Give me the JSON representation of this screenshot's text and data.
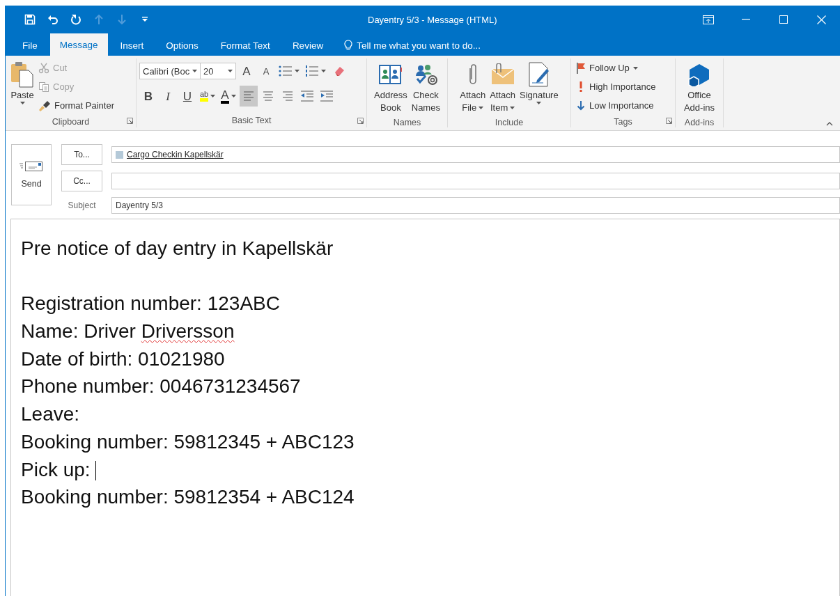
{
  "window": {
    "title": "Dayentry 5/3 - Message (HTML)"
  },
  "quick_access": [
    {
      "kind": "save",
      "disabled": false
    },
    {
      "kind": "undo",
      "disabled": false
    },
    {
      "kind": "redo",
      "disabled": false
    },
    {
      "kind": "up",
      "disabled": true
    },
    {
      "kind": "down",
      "disabled": true
    },
    {
      "kind": "customize",
      "disabled": false
    }
  ],
  "window_controls": [
    {
      "kind": "ribbon-display"
    },
    {
      "kind": "minimize"
    },
    {
      "kind": "maximize"
    },
    {
      "kind": "close"
    }
  ],
  "tabs": [
    {
      "label": "File",
      "selected": false
    },
    {
      "label": "Message",
      "selected": true
    },
    {
      "label": "Insert",
      "selected": false
    },
    {
      "label": "Options",
      "selected": false
    },
    {
      "label": "Format Text",
      "selected": false
    },
    {
      "label": "Review",
      "selected": false
    }
  ],
  "tell_me": {
    "placeholder": "Tell me what you want to do..."
  },
  "ribbon": {
    "groups": [
      {
        "kind": "clipboard",
        "label": "Clipboard",
        "launcher": true,
        "paste": {
          "label": "Paste",
          "dropdown": true
        },
        "items": [
          {
            "kind": "cut",
            "label": "Cut",
            "disabled": true
          },
          {
            "kind": "copy",
            "label": "Copy",
            "disabled": true
          },
          {
            "kind": "format-painter",
            "label": "Format Painter",
            "disabled": false
          }
        ]
      },
      {
        "kind": "basic-text",
        "label": "Basic Text",
        "launcher": true,
        "font": "Calibri (Boc",
        "size": "20",
        "row_1": [
          {
            "kind": "grow-font",
            "glyph": "A"
          },
          {
            "kind": "shrink-font",
            "glyph": "A"
          },
          {
            "kind": "bullets",
            "dropdown": true
          },
          {
            "kind": "numbering",
            "dropdown": true
          },
          {
            "kind": "clear-formatting"
          }
        ],
        "row_2": [
          {
            "kind": "bold",
            "glyph": "B"
          },
          {
            "kind": "italic",
            "glyph": "I"
          },
          {
            "kind": "underline",
            "glyph": "U"
          },
          {
            "kind": "highlight",
            "glyph": "ab",
            "dropdown": true
          },
          {
            "kind": "font-color",
            "glyph": "A",
            "dropdown": true
          },
          {
            "kind": "align-left",
            "selected": true
          },
          {
            "kind": "align-center",
            "selected": false
          },
          {
            "kind": "align-right",
            "selected": false
          },
          {
            "kind": "outdent"
          },
          {
            "kind": "indent"
          }
        ]
      },
      {
        "kind": "large-buttons",
        "label": "Names",
        "launcher": false,
        "buttons": [
          {
            "kind": "address-book",
            "lines": [
              "Address",
              "Book"
            ],
            "dropdown": false
          },
          {
            "kind": "check-names",
            "lines": [
              "Check",
              "Names"
            ],
            "dropdown": false
          }
        ]
      },
      {
        "kind": "large-buttons",
        "label": "Include",
        "launcher": false,
        "buttons": [
          {
            "kind": "attach-file",
            "lines": [
              "Attach",
              "File"
            ],
            "dropdown": true
          },
          {
            "kind": "attach-item",
            "lines": [
              "Attach",
              "Item"
            ],
            "dropdown": true
          },
          {
            "kind": "signature",
            "lines": [
              "Signature"
            ],
            "dropdown": true
          }
        ]
      },
      {
        "kind": "small-buttons",
        "label": "Tags",
        "launcher": true,
        "items": [
          {
            "kind": "follow-up",
            "label": "Follow Up",
            "dropdown": true
          },
          {
            "kind": "high-importance",
            "label": "High Importance",
            "dropdown": false
          },
          {
            "kind": "low-importance",
            "label": "Low Importance",
            "dropdown": false
          }
        ]
      },
      {
        "kind": "large-buttons",
        "label": "Add-ins",
        "launcher": false,
        "buttons": [
          {
            "kind": "office-addins",
            "lines": [
              "Office",
              "Add-ins"
            ],
            "dropdown": false
          }
        ]
      }
    ]
  },
  "header": {
    "send": "Send",
    "to": {
      "button": "To...",
      "recipients": [
        {
          "name": "Cargo Checkin Kapellskär"
        }
      ]
    },
    "cc": {
      "button": "Cc..."
    },
    "subject": {
      "label": "Subject",
      "value": "Dayentry 5/3"
    }
  },
  "body": {
    "lines": [
      {
        "text": "Pre notice of day entry in Kapellskär",
        "gap_after": true
      },
      {
        "text": "Registration number: 123ABC"
      },
      {
        "text": "Name: Driver ",
        "misspelled": "Driversson"
      },
      {
        "text": "Date of birth: 01021980"
      },
      {
        "text": "Phone number: 0046731234567"
      },
      {
        "text": "Leave:"
      },
      {
        "text": "Booking number: 59812345 + ABC123"
      },
      {
        "text": "Pick up: ",
        "cursor": true
      },
      {
        "text": "Booking number: 59812354 + ABC124"
      }
    ]
  }
}
